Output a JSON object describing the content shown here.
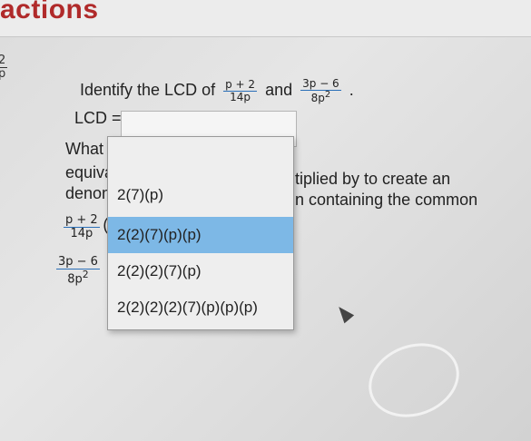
{
  "header": {
    "section_title": "actions"
  },
  "left_fraction": {
    "num": "2",
    "den": "p"
  },
  "question": {
    "prefix": "Identify the LCD of",
    "f1_num": "p + 2",
    "f1_den": "14p",
    "conj": "and",
    "f2_num": "3p − 6",
    "f2_den": "8p",
    "f2_den_exp": "2",
    "end": "."
  },
  "lcd": {
    "label": "LCD =",
    "selected_value": ""
  },
  "para": {
    "line1_start": "What i",
    "line1_end": "tiplied by to create an",
    "line2_start": "equiva",
    "line3_start": "denom",
    "line3_end": "n containing the common"
  },
  "eq_fractions": {
    "f1_num": "p + 2",
    "f1_den": "14p",
    "f1_paren": "(",
    "f2_num": "3p − 6",
    "f2_den": "8p",
    "f2_den_exp": "2"
  },
  "dropdown": {
    "options": [
      "2(7)(p)",
      "2(2)(7)(p)(p)",
      "2(2)(2)(7)(p)",
      "2(2)(2)(2)(7)(p)(p)(p)"
    ],
    "highlighted_index": 1
  },
  "colors": {
    "accent": "#b02a2a",
    "highlight": "#7db8e6",
    "fraction_bar": "#2a6fb8"
  }
}
